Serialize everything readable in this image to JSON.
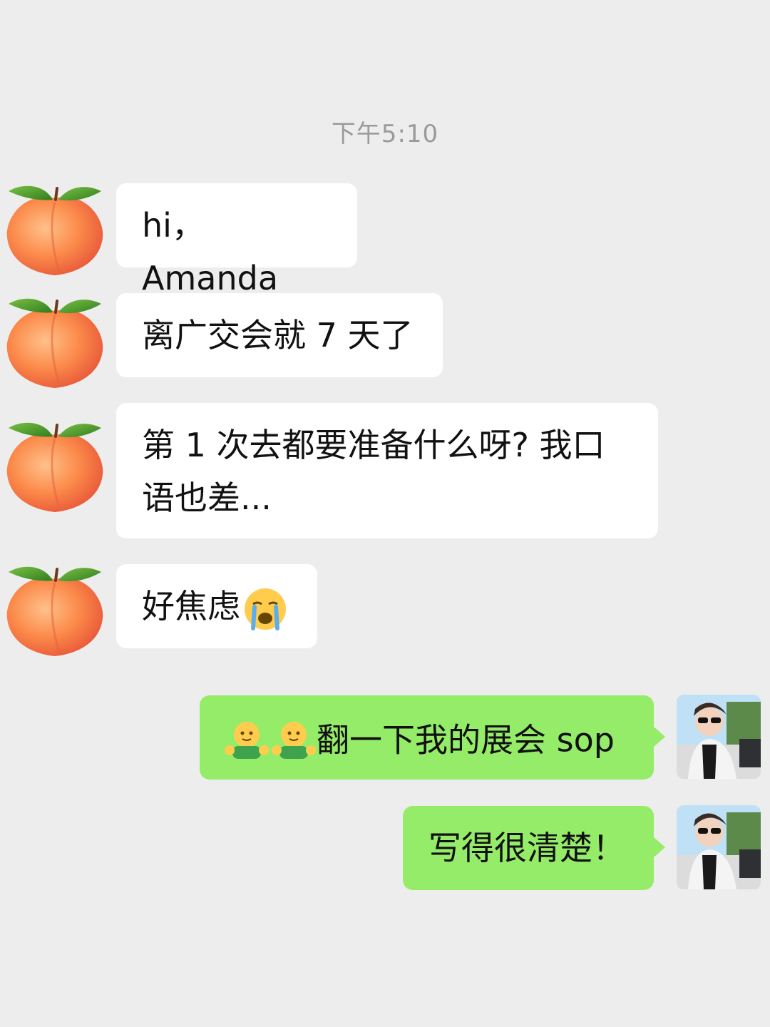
{
  "chat": {
    "timestamp": "下午5:10",
    "incoming": [
      {
        "text": "hi，Amanda",
        "avatar_icon": "peach-icon"
      },
      {
        "text": "离广交会就 7 天了",
        "avatar_icon": "peach-icon"
      },
      {
        "text": "第 1 次去都要准备什么呀? 我口语也差...",
        "avatar_icon": "peach-icon"
      },
      {
        "text": "好焦虑",
        "trailing_emoji": "crying-face-icon",
        "avatar_icon": "peach-icon"
      }
    ],
    "outgoing": [
      {
        "text": "翻一下我的展会 sop",
        "leading_emoji": "hugging-face-icon",
        "avatar_icon": "user-photo-avatar"
      },
      {
        "text": "写得很清楚！",
        "avatar_icon": "user-photo-avatar"
      }
    ]
  },
  "colors": {
    "background": "#ededed",
    "incoming_bubble": "#ffffff",
    "outgoing_bubble": "#95ec69",
    "timestamp": "#9a9a9a"
  }
}
